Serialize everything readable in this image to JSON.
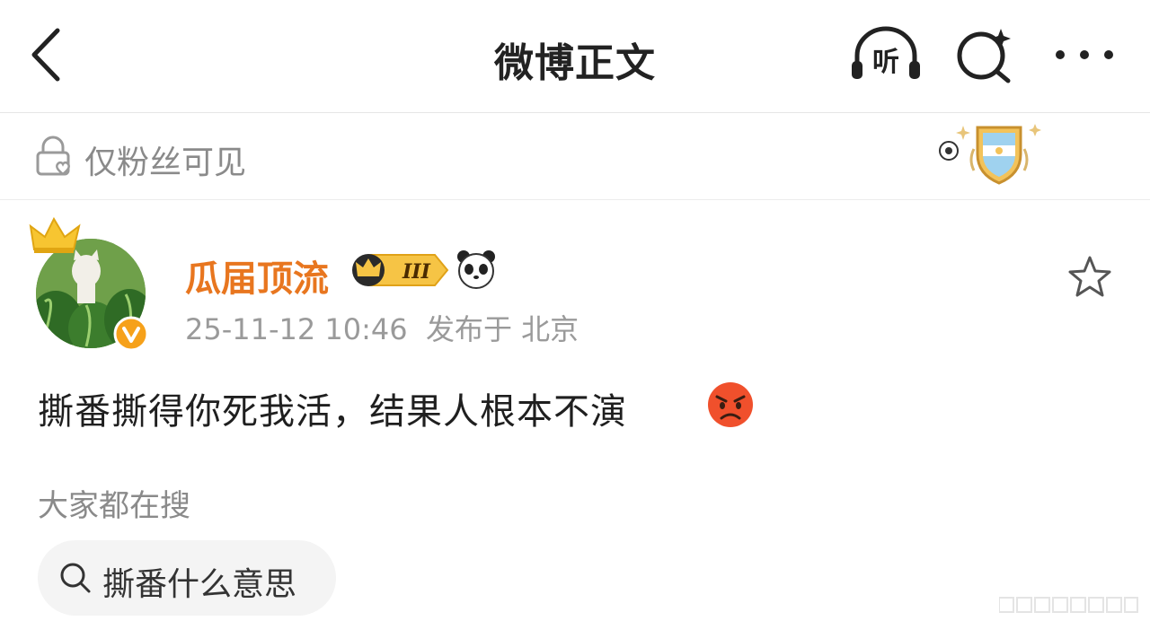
{
  "header": {
    "title": "微博正文",
    "listen_label": "听",
    "icons": [
      "back-arrow-icon",
      "listen-headphones-icon",
      "search-sparkle-icon",
      "more-dots-icon"
    ]
  },
  "visibility": {
    "text": "仅粉丝可见",
    "icon": "lock-heart-icon"
  },
  "post": {
    "author": "瓜届顶流",
    "vip_level": "III",
    "timestamp": "25-11-12 10:46",
    "location_label": "发布于 北京",
    "text": "撕番撕得你死我活，结果人根本不演",
    "emoji": "angry-face-icon"
  },
  "trending": {
    "label": "大家都在搜",
    "chips": [
      {
        "label": "撕番什么意思",
        "icon": "search-icon"
      }
    ]
  },
  "colors": {
    "username": "#e8761f",
    "secondary_text": "#9a9a9a",
    "chip_bg": "#f4f4f4"
  }
}
